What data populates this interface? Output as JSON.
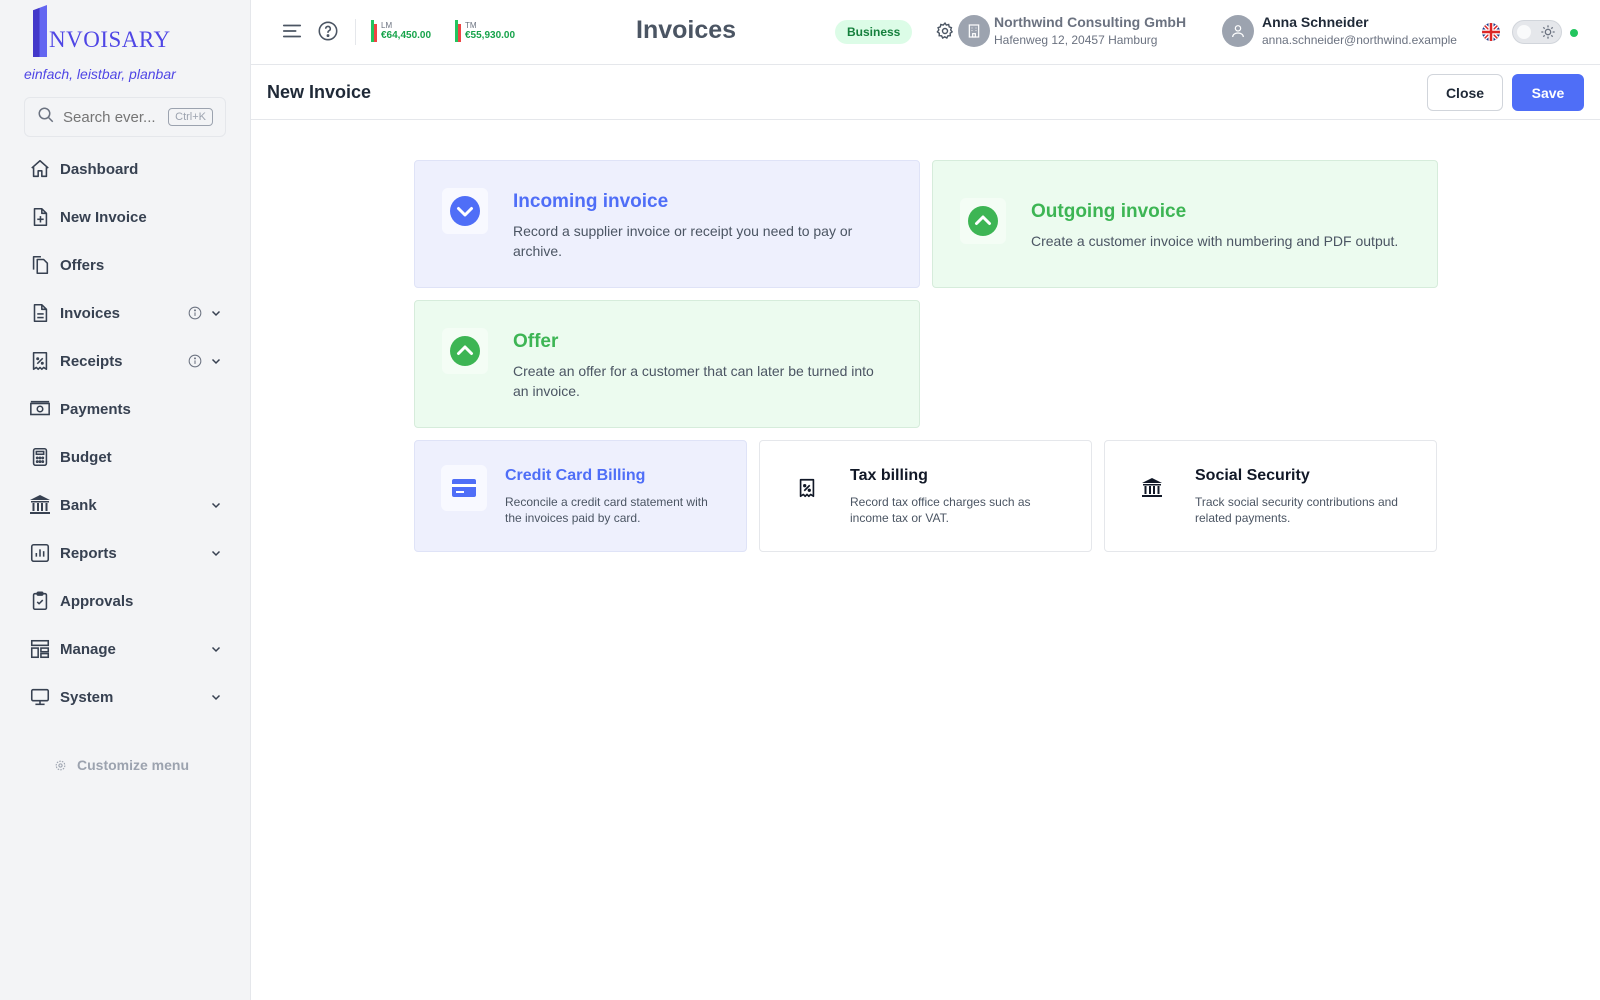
{
  "brand": {
    "logo_text": "NVOISARY",
    "tagline": "einfach, leistbar, planbar",
    "accent": "#4f46e5"
  },
  "search": {
    "placeholder": "Search ever...",
    "shortcut": "Ctrl+K"
  },
  "sidebar": {
    "items": [
      {
        "label": "Dashboard",
        "icon": "home-icon"
      },
      {
        "label": "New Invoice",
        "icon": "file-plus-icon"
      },
      {
        "label": "Offers",
        "icon": "copy-icon"
      },
      {
        "label": "Invoices",
        "icon": "document-icon",
        "info": true,
        "expandable": true
      },
      {
        "label": "Receipts",
        "icon": "receipt-icon",
        "info": true,
        "expandable": true
      },
      {
        "label": "Payments",
        "icon": "cash-icon"
      },
      {
        "label": "Budget",
        "icon": "calculator-icon"
      },
      {
        "label": "Bank",
        "icon": "bank-icon",
        "expandable": true
      },
      {
        "label": "Reports",
        "icon": "chart-icon",
        "expandable": true
      },
      {
        "label": "Approvals",
        "icon": "clipboard-check-icon"
      },
      {
        "label": "Manage",
        "icon": "layout-icon",
        "expandable": true
      },
      {
        "label": "System",
        "icon": "monitor-icon",
        "expandable": true
      }
    ],
    "customize_label": "Customize menu"
  },
  "topbar": {
    "stats": [
      {
        "label": "LM",
        "value": "€64,450.00"
      },
      {
        "label": "TM",
        "value": "€55,930.00"
      }
    ],
    "page_title": "Invoices",
    "plan_badge": "Business",
    "company": {
      "name": "Northwind Consulting GmbH",
      "address": "Hafenweg 12, 20457 Hamburg"
    },
    "user": {
      "name": "Anna Schneider",
      "email": "anna.schneider@northwind.example"
    }
  },
  "header": {
    "title": "New Invoice",
    "close_label": "Close",
    "save_label": "Save"
  },
  "cards": {
    "incoming": {
      "title": "Incoming invoice",
      "desc": "Record a supplier invoice or receipt you need to pay or archive."
    },
    "outgoing": {
      "title": "Outgoing invoice",
      "desc": "Create a customer invoice with numbering and PDF output."
    },
    "offer": {
      "title": "Offer",
      "desc": "Create an offer for a customer that can later be turned into an invoice."
    },
    "credit_card": {
      "title": "Credit Card Billing",
      "desc": "Reconcile a credit card statement with the invoices paid by card."
    },
    "tax": {
      "title": "Tax billing",
      "desc": "Record tax office charges such as income tax or VAT."
    },
    "social": {
      "title": "Social Security",
      "desc": "Track social security contributions and related payments."
    }
  },
  "colors": {
    "blue": "#4f6ef7",
    "green": "#3db554",
    "online": "#22c55e"
  }
}
